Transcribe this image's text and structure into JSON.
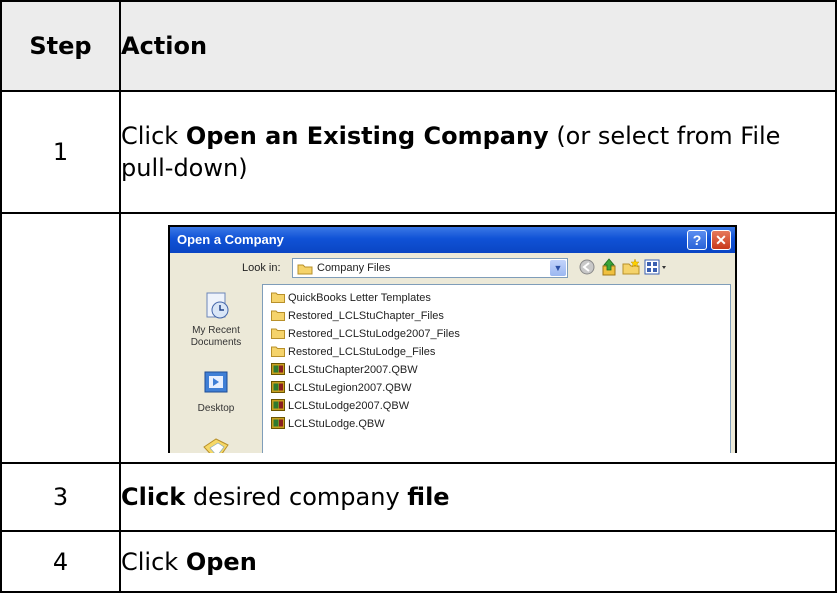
{
  "table": {
    "headers": {
      "step": "Step",
      "action": "Action"
    },
    "rows": [
      {
        "step": "1",
        "pre": "Click ",
        "bold": "Open an Existing Company",
        "post": " (or select from File pull-down)"
      },
      {
        "step": ""
      },
      {
        "step": "3",
        "bold1": "Click",
        "mid": " desired company ",
        "bold2": "file"
      },
      {
        "step": "4",
        "pre": "Click ",
        "bold": "Open"
      }
    ]
  },
  "dialog": {
    "title": "Open a Company",
    "help_label": "?",
    "close_label": "✕",
    "look_in_label": "Look in:",
    "look_in_value": "Company Files",
    "places": [
      "My Recent Documents",
      "Desktop"
    ],
    "files": [
      {
        "name": "QuickBooks Letter Templates",
        "type": "folder"
      },
      {
        "name": "Restored_LCLStuChapter_Files",
        "type": "folder"
      },
      {
        "name": "Restored_LCLStuLodge2007_Files",
        "type": "folder"
      },
      {
        "name": "Restored_LCLStuLodge_Files",
        "type": "folder"
      },
      {
        "name": "LCLStuChapter2007.QBW",
        "type": "qbw"
      },
      {
        "name": "LCLStuLegion2007.QBW",
        "type": "qbw"
      },
      {
        "name": "LCLStuLodge2007.QBW",
        "type": "qbw"
      },
      {
        "name": "LCLStuLodge.QBW",
        "type": "qbw"
      }
    ]
  }
}
